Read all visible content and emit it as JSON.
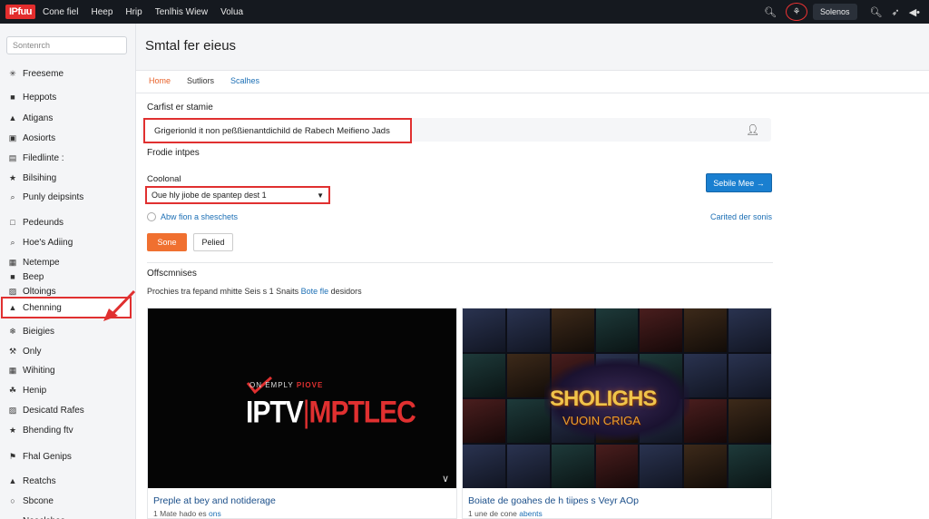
{
  "topbar": {
    "logo": "IPfuu",
    "nav": [
      "Cone fiel",
      "Heep",
      "Hrip",
      "Tenlhis Wiew",
      "Volua"
    ],
    "search_icon": "search-icon",
    "circle_icon": "link-icon",
    "account_button": "Solenos",
    "extra_icons": [
      "search-icon",
      "pin-icon",
      "speaker-icon"
    ]
  },
  "sidebar": {
    "search_placeholder": "Sontenrch",
    "items": [
      {
        "label": "Freeseme",
        "icon": "asterisk-icon"
      },
      {
        "label": "Heppots",
        "icon": "square-icon"
      },
      {
        "label": "Atigans",
        "icon": "person-icon"
      },
      {
        "label": "Aosiorts",
        "icon": "bag-icon"
      },
      {
        "label": "Filedlinte :",
        "icon": "film-icon"
      },
      {
        "label": "Bilsihing",
        "icon": "star-icon"
      },
      {
        "label": "Punly deipsints",
        "icon": "search-icon"
      },
      {
        "label": "Pedeunds",
        "icon": "box-icon"
      },
      {
        "label": "Hoe's Adiing",
        "icon": "search-icon"
      },
      {
        "label": "Netempe",
        "icon": "grid-icon"
      },
      {
        "label": "Beep",
        "icon": "square-icon"
      },
      {
        "label": "Oltoings",
        "icon": "hash-icon"
      },
      {
        "label": "Chenning",
        "icon": "person-icon"
      },
      {
        "label": "Bieigies",
        "icon": "snow-icon"
      },
      {
        "label": "Only",
        "icon": "wrench-icon"
      },
      {
        "label": "Wihiting",
        "icon": "grid-icon"
      },
      {
        "label": "Henip",
        "icon": "leaf-icon"
      },
      {
        "label": "Desicatd Rafes",
        "icon": "hash-icon"
      },
      {
        "label": "Bhending ftv",
        "icon": "star-icon"
      },
      {
        "label": "Fhal Genips",
        "icon": "flag-icon"
      },
      {
        "label": "Reatchs",
        "icon": "person-icon"
      },
      {
        "label": "Sbcone",
        "icon": "circle-icon"
      },
      {
        "label": "Neaclshes",
        "icon": "circle-icon"
      }
    ],
    "active_index": 12
  },
  "main": {
    "title": "Smtal fer eieus",
    "tabs": [
      "Home",
      "Sutliors",
      "Scalhes"
    ],
    "section1_label": "Carfist er stamie",
    "input_value": "Grigerionld it non peßßienantdichild de Rabech Meifieno Jads",
    "user_icon": "user-icon",
    "section2_label": "Frodie intpes",
    "select_label": "Coolonal",
    "select_value": "Oue hly jiobe de spantep dest 1",
    "primary_button": "Sebile Mee →",
    "radio_label": "Abw fion a sheschets",
    "right_link": "Carited der sonis",
    "btn_save": "Sone",
    "btn_other": "Pelied",
    "section3_label": "Offscmnises",
    "desc_text": "Prochies tra fepand mhitte Seis s 1 Snaits",
    "desc_link": "Bote fle",
    "desc_tail": "desidors",
    "card1": {
      "brand_top": "ON EMPLY",
      "brand_top_red": "PIOVE",
      "brand_main": "IPTV",
      "brand_main_red": "MPTLEC",
      "title": "Preple at bey and notiderage",
      "sub_text": "1 Mate hado es",
      "sub_link": "ons",
      "chevron_icon": "chevron-down-icon"
    },
    "card2": {
      "show_title": "SHOLIGHS",
      "show_subtitle": "VUOIN CRIGA",
      "title": "Boiate de goahes de h tiipes s Veyr AOp",
      "sub_text": "1 une de cone",
      "sub_link": "abents"
    }
  },
  "colors": {
    "accent_red": "#e03030",
    "link_blue": "#1c6fb5",
    "orange": "#f07030",
    "primary_blue": "#1a7fd0",
    "topbar_bg": "#15191f"
  }
}
